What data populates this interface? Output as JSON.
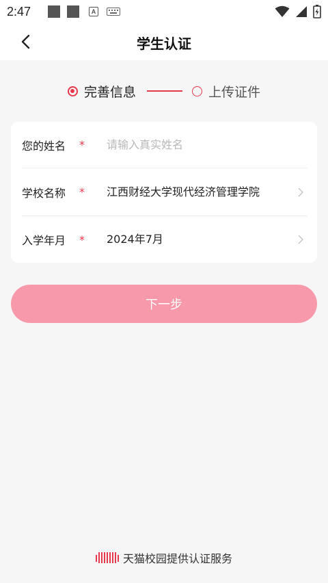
{
  "status_bar": {
    "time": "2:47",
    "icons": [
      "notification-square-icon",
      "notification-square-icon",
      "a-box-icon",
      "keyboard-icon",
      "wifi-icon",
      "signal-icon",
      "battery-icon"
    ]
  },
  "header": {
    "title": "学生认证",
    "back_icon": "chevron-left-icon"
  },
  "steps": [
    {
      "label": "完善信息",
      "state": "active"
    },
    {
      "label": "上传证件",
      "state": "inactive"
    }
  ],
  "form": {
    "name": {
      "label": "您的姓名",
      "required_mark": "*",
      "placeholder": "请输入真实姓名",
      "value": ""
    },
    "school": {
      "label": "学校名称",
      "required_mark": "*",
      "value": "江西财经大学现代经济管理学院"
    },
    "enroll": {
      "label": "入学年月",
      "required_mark": "*",
      "value": "2024年7月"
    }
  },
  "next_button": {
    "label": "下一步"
  },
  "footer": {
    "text": "天猫校园提供认证服务",
    "icon": "tmall-barcode-icon"
  },
  "colors": {
    "accent": "#e8364c",
    "button": "#f899aa",
    "background": "#f6f6f6"
  }
}
